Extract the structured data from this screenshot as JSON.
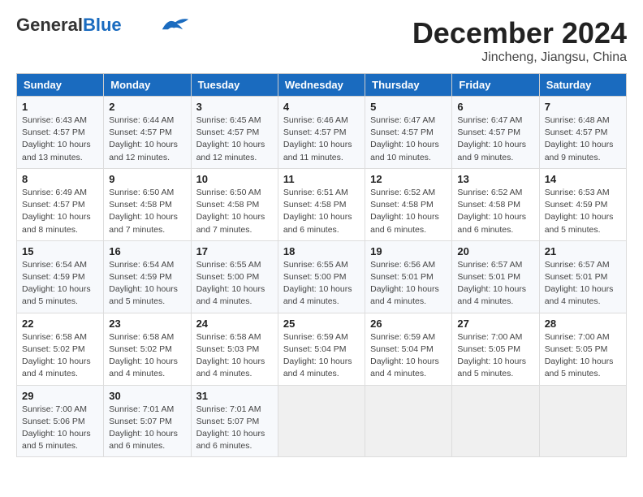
{
  "header": {
    "logo_general": "General",
    "logo_blue": "Blue",
    "title": "December 2024",
    "subtitle": "Jincheng, Jiangsu, China"
  },
  "weekdays": [
    "Sunday",
    "Monday",
    "Tuesday",
    "Wednesday",
    "Thursday",
    "Friday",
    "Saturday"
  ],
  "weeks": [
    [
      {
        "day": 1,
        "sunrise": "6:43 AM",
        "sunset": "4:57 PM",
        "daylight": "10 hours and 13 minutes."
      },
      {
        "day": 2,
        "sunrise": "6:44 AM",
        "sunset": "4:57 PM",
        "daylight": "10 hours and 12 minutes."
      },
      {
        "day": 3,
        "sunrise": "6:45 AM",
        "sunset": "4:57 PM",
        "daylight": "10 hours and 12 minutes."
      },
      {
        "day": 4,
        "sunrise": "6:46 AM",
        "sunset": "4:57 PM",
        "daylight": "10 hours and 11 minutes."
      },
      {
        "day": 5,
        "sunrise": "6:47 AM",
        "sunset": "4:57 PM",
        "daylight": "10 hours and 10 minutes."
      },
      {
        "day": 6,
        "sunrise": "6:47 AM",
        "sunset": "4:57 PM",
        "daylight": "10 hours and 9 minutes."
      },
      {
        "day": 7,
        "sunrise": "6:48 AM",
        "sunset": "4:57 PM",
        "daylight": "10 hours and 9 minutes."
      }
    ],
    [
      {
        "day": 8,
        "sunrise": "6:49 AM",
        "sunset": "4:57 PM",
        "daylight": "10 hours and 8 minutes."
      },
      {
        "day": 9,
        "sunrise": "6:50 AM",
        "sunset": "4:58 PM",
        "daylight": "10 hours and 7 minutes."
      },
      {
        "day": 10,
        "sunrise": "6:50 AM",
        "sunset": "4:58 PM",
        "daylight": "10 hours and 7 minutes."
      },
      {
        "day": 11,
        "sunrise": "6:51 AM",
        "sunset": "4:58 PM",
        "daylight": "10 hours and 6 minutes."
      },
      {
        "day": 12,
        "sunrise": "6:52 AM",
        "sunset": "4:58 PM",
        "daylight": "10 hours and 6 minutes."
      },
      {
        "day": 13,
        "sunrise": "6:52 AM",
        "sunset": "4:58 PM",
        "daylight": "10 hours and 6 minutes."
      },
      {
        "day": 14,
        "sunrise": "6:53 AM",
        "sunset": "4:59 PM",
        "daylight": "10 hours and 5 minutes."
      }
    ],
    [
      {
        "day": 15,
        "sunrise": "6:54 AM",
        "sunset": "4:59 PM",
        "daylight": "10 hours and 5 minutes."
      },
      {
        "day": 16,
        "sunrise": "6:54 AM",
        "sunset": "4:59 PM",
        "daylight": "10 hours and 5 minutes."
      },
      {
        "day": 17,
        "sunrise": "6:55 AM",
        "sunset": "5:00 PM",
        "daylight": "10 hours and 4 minutes."
      },
      {
        "day": 18,
        "sunrise": "6:55 AM",
        "sunset": "5:00 PM",
        "daylight": "10 hours and 4 minutes."
      },
      {
        "day": 19,
        "sunrise": "6:56 AM",
        "sunset": "5:01 PM",
        "daylight": "10 hours and 4 minutes."
      },
      {
        "day": 20,
        "sunrise": "6:57 AM",
        "sunset": "5:01 PM",
        "daylight": "10 hours and 4 minutes."
      },
      {
        "day": 21,
        "sunrise": "6:57 AM",
        "sunset": "5:01 PM",
        "daylight": "10 hours and 4 minutes."
      }
    ],
    [
      {
        "day": 22,
        "sunrise": "6:58 AM",
        "sunset": "5:02 PM",
        "daylight": "10 hours and 4 minutes."
      },
      {
        "day": 23,
        "sunrise": "6:58 AM",
        "sunset": "5:02 PM",
        "daylight": "10 hours and 4 minutes."
      },
      {
        "day": 24,
        "sunrise": "6:58 AM",
        "sunset": "5:03 PM",
        "daylight": "10 hours and 4 minutes."
      },
      {
        "day": 25,
        "sunrise": "6:59 AM",
        "sunset": "5:04 PM",
        "daylight": "10 hours and 4 minutes."
      },
      {
        "day": 26,
        "sunrise": "6:59 AM",
        "sunset": "5:04 PM",
        "daylight": "10 hours and 4 minutes."
      },
      {
        "day": 27,
        "sunrise": "7:00 AM",
        "sunset": "5:05 PM",
        "daylight": "10 hours and 5 minutes."
      },
      {
        "day": 28,
        "sunrise": "7:00 AM",
        "sunset": "5:05 PM",
        "daylight": "10 hours and 5 minutes."
      }
    ],
    [
      {
        "day": 29,
        "sunrise": "7:00 AM",
        "sunset": "5:06 PM",
        "daylight": "10 hours and 5 minutes."
      },
      {
        "day": 30,
        "sunrise": "7:01 AM",
        "sunset": "5:07 PM",
        "daylight": "10 hours and 6 minutes."
      },
      {
        "day": 31,
        "sunrise": "7:01 AM",
        "sunset": "5:07 PM",
        "daylight": "10 hours and 6 minutes."
      },
      null,
      null,
      null,
      null
    ]
  ]
}
